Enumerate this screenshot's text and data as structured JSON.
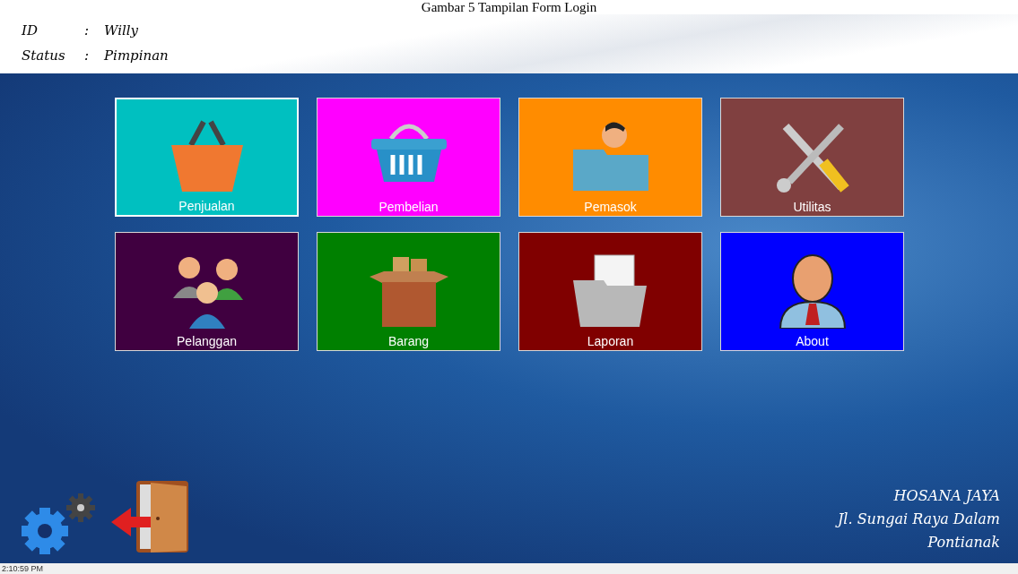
{
  "caption": "Gambar 5 Tampilan Form Login",
  "user": {
    "id_label": "ID",
    "id_value": "Willy",
    "status_label": "Status",
    "status_value": "Pimpinan",
    "separator": ":"
  },
  "tiles": [
    {
      "label": "Penjualan",
      "kind": "basket",
      "color": "#00c0c0",
      "selected": true
    },
    {
      "label": "Pembelian",
      "kind": "cart",
      "color": "#ff00ff",
      "selected": false
    },
    {
      "label": "Pemasok",
      "kind": "supplier",
      "color": "#ff8c00",
      "selected": false
    },
    {
      "label": "Utilitas",
      "kind": "tools",
      "color": "#804040",
      "selected": false
    },
    {
      "label": "Pelanggan",
      "kind": "people",
      "color": "#400040",
      "selected": false
    },
    {
      "label": "Barang",
      "kind": "box",
      "color": "#008000",
      "selected": false
    },
    {
      "label": "Laporan",
      "kind": "folder",
      "color": "#800000",
      "selected": false
    },
    {
      "label": "About",
      "kind": "person",
      "color": "#0000ff",
      "selected": false
    }
  ],
  "company": {
    "name": "HOSANA JAYA",
    "address": "Jl. Sungai Raya Dalam",
    "city": "Pontianak"
  },
  "status_bar": {
    "time": "2:10:59 PM"
  }
}
